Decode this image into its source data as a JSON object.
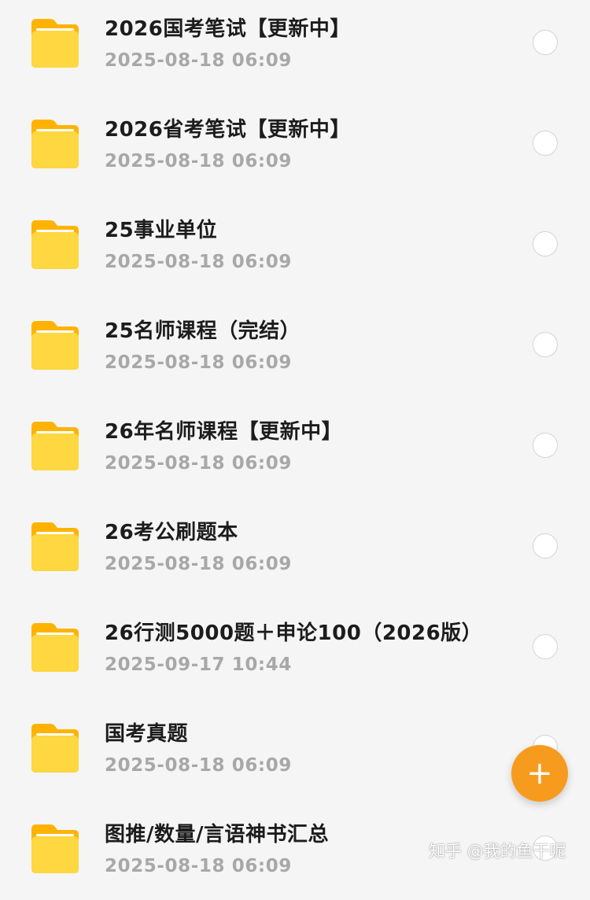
{
  "files": [
    {
      "name": "2026国考笔试【更新中】",
      "date": "2025-08-18 06:09"
    },
    {
      "name": "2026省考笔试【更新中】",
      "date": "2025-08-18 06:09"
    },
    {
      "name": "25事业单位",
      "date": "2025-08-18 06:09"
    },
    {
      "name": "25名师课程（完结）",
      "date": "2025-08-18 06:09"
    },
    {
      "name": "26年名师课程【更新中】",
      "date": "2025-08-18 06:09"
    },
    {
      "name": "26考公刷题本",
      "date": "2025-08-18 06:09"
    },
    {
      "name": "26行测5000题＋申论100（2026版）",
      "date": "2025-09-17 10:44"
    },
    {
      "name": "国考真题",
      "date": "2025-08-18 06:09"
    },
    {
      "name": "图推/数量/言语神书汇总",
      "date": "2025-08-18 06:09"
    }
  ],
  "fab": {
    "icon": "plus-icon",
    "label": "+"
  },
  "watermark": "知乎 @我的鱼干呢",
  "colors": {
    "background": "#f5f5f5",
    "folder_yellow": "#ffd740",
    "folder_tab": "#ffb300",
    "fab": "#f79b1e",
    "date_text": "#a8a8a8"
  }
}
